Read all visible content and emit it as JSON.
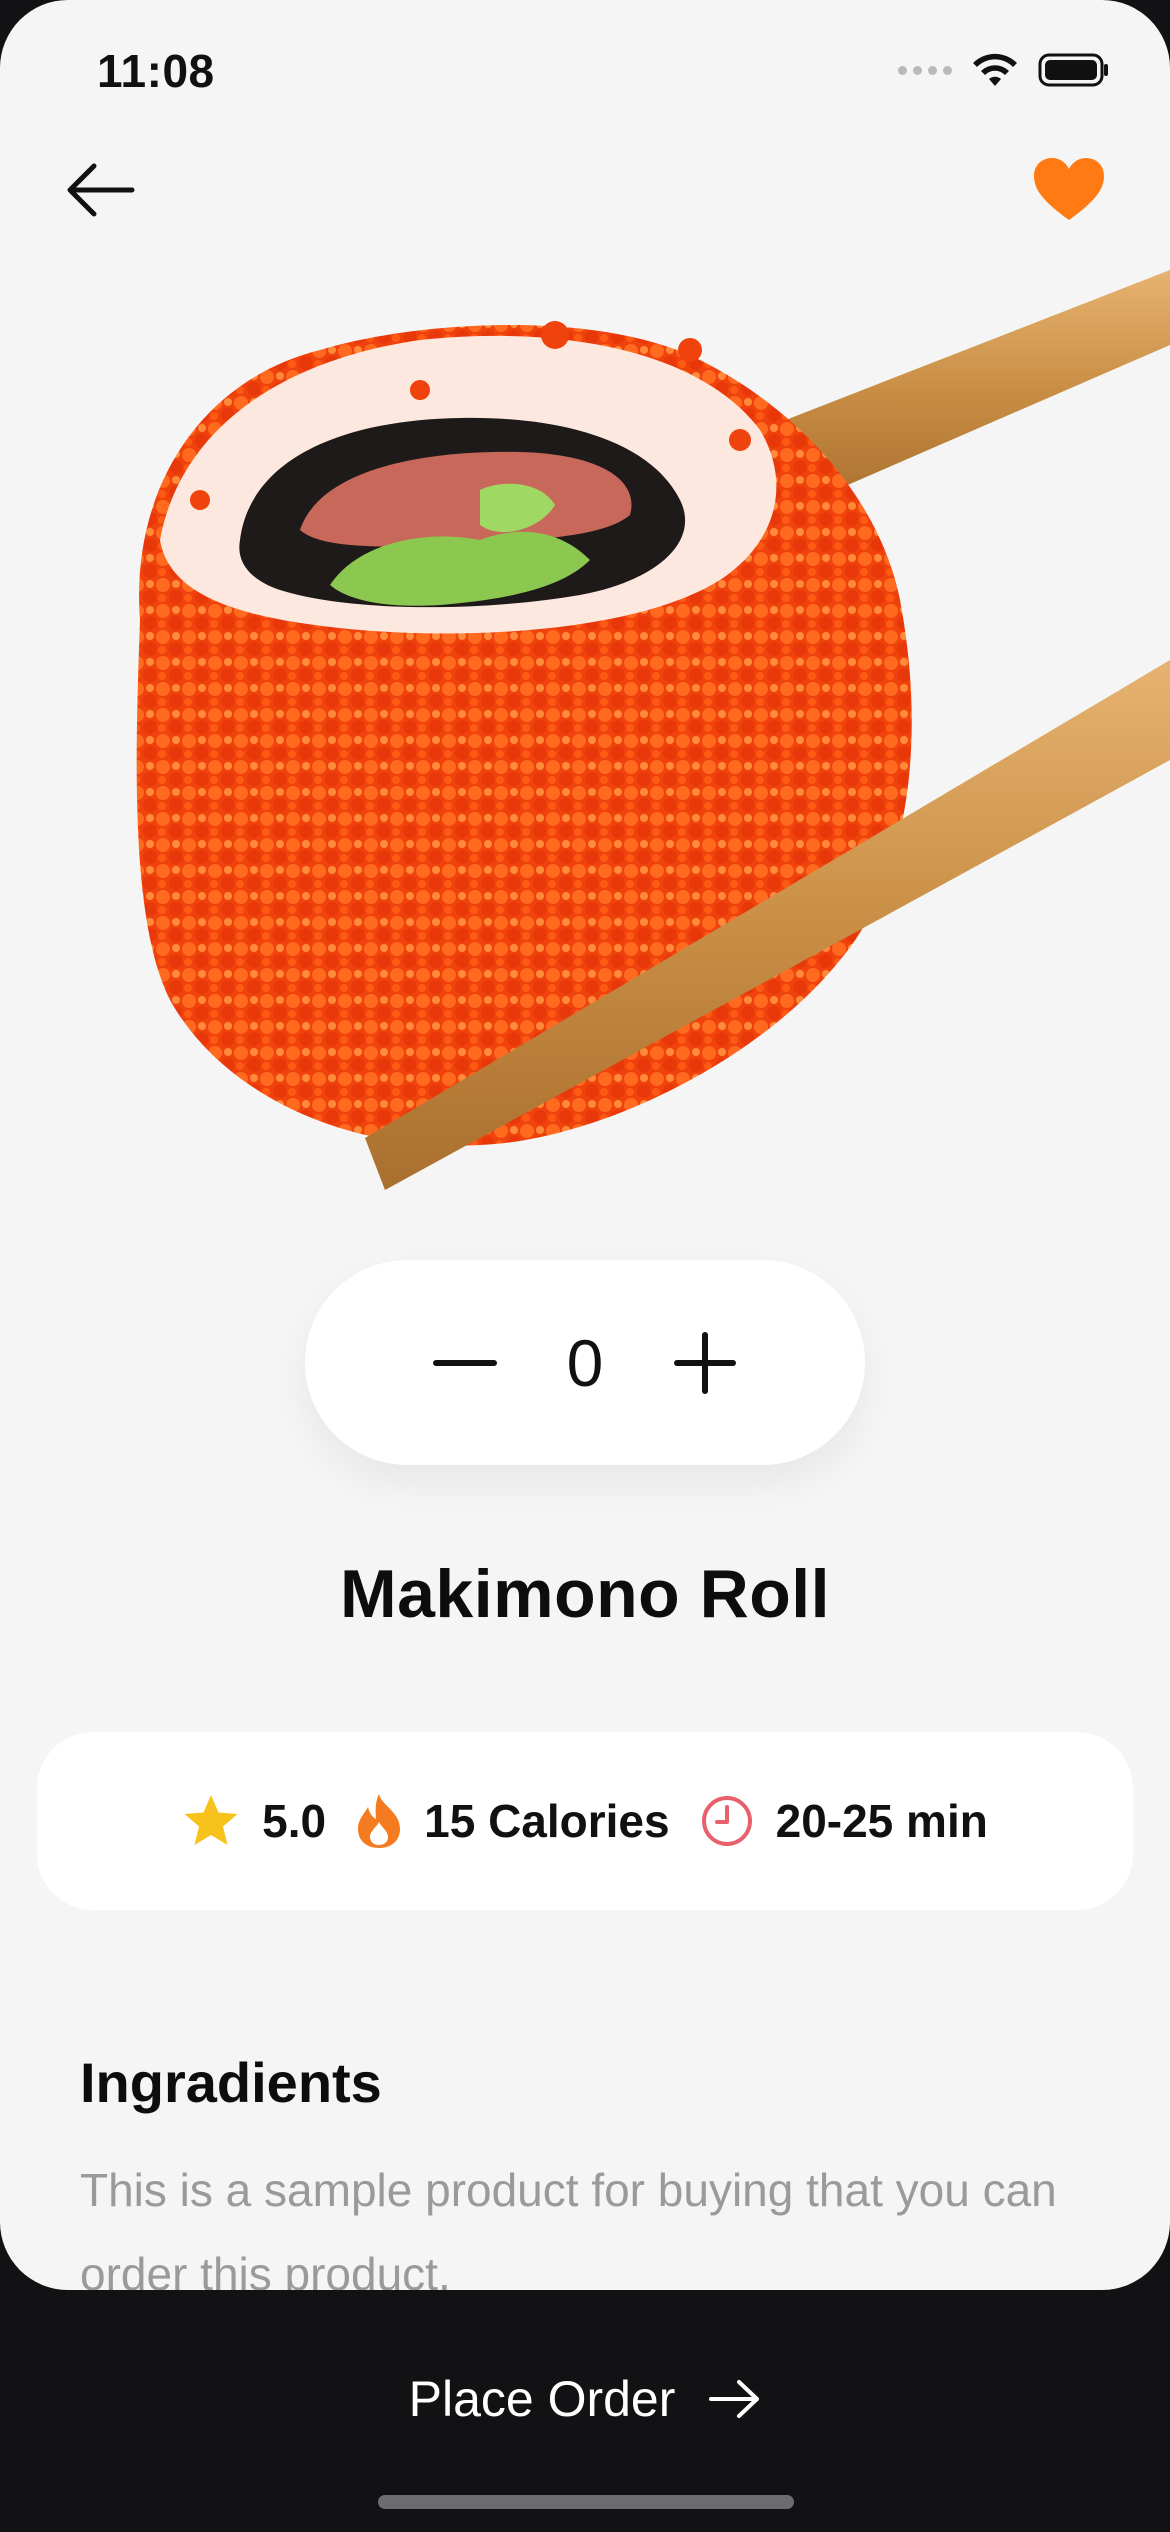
{
  "status_bar": {
    "time": "11:08"
  },
  "nav": {
    "back_icon": "arrow-left-icon",
    "favorite_icon": "heart-icon",
    "favorite_color": "#FF7A12"
  },
  "product": {
    "image": "sushi-roll-with-chopsticks",
    "quantity": "0",
    "name": "Makimono Roll"
  },
  "info": {
    "rating": "5.0",
    "calories": "15 Calories",
    "time": "20-25 min",
    "rating_icon": "star-icon",
    "calories_icon": "flame-icon",
    "time_icon": "clock-icon",
    "star_color": "#F8C21C",
    "flame_color": "#F47B1F",
    "clock_color": "#E8606B"
  },
  "ingredients": {
    "title": "Ingradients",
    "description": "This is a sample product for buying that you can order this product."
  },
  "footer": {
    "order_label": "Place Order",
    "order_icon": "arrow-right-icon"
  }
}
